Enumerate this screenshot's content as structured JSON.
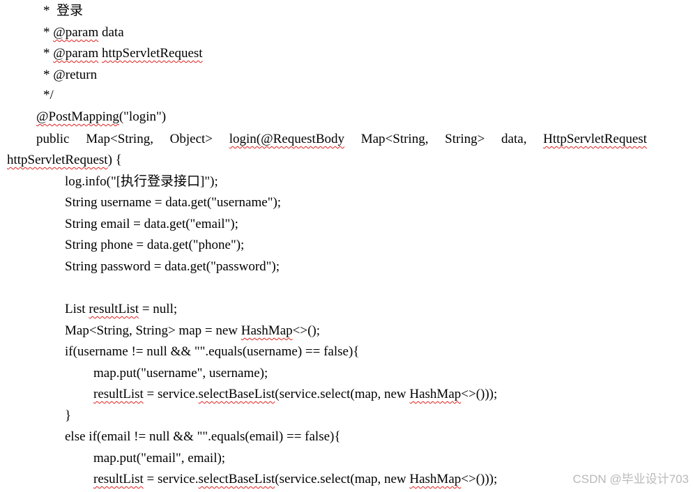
{
  "comment": {
    "l1_prefix": "*  ",
    "l1_text": "登录",
    "l2_prefix": "* ",
    "l2_tag": "@param",
    "l2_text": " data",
    "l3_prefix": "* ",
    "l3_tag": "@param",
    "l3_sep": " ",
    "l3_name": "httpServletRequest",
    "l4": "* @return",
    "l5": "*/"
  },
  "annotation": {
    "name": "@PostMapping",
    "arg": "(\"login\")"
  },
  "signature": {
    "tokens": [
      "public",
      "Map<String,",
      "Object>",
      "login(@RequestBody",
      "Map<String,",
      "String>",
      "data,",
      "HttpServletRequest"
    ],
    "squiggle_tokens": [
      3,
      7
    ],
    "line2_name": "httpServletRequest",
    "line2_rest": ") {"
  },
  "body": {
    "log": "log.info(\"[执行登录接口]\");",
    "username": "String username = data.get(\"username\");",
    "email": "String email = data.get(\"email\");",
    "phone": "String phone = data.get(\"phone\");",
    "password": "String password = data.get(\"password\");",
    "list_a": "List ",
    "list_b": "resultList",
    "list_c": " = null;",
    "map_a": "Map<String, String> map = new ",
    "map_b": "HashMap",
    "map_c": "<>();",
    "if1": "if(username != null && \"\".equals(username) == false){",
    "put_username": "map.put(\"username\", username);",
    "rl1_a": "resultList",
    "rl1_b": " = service.",
    "rl1_c": "selectBaseList",
    "rl1_d": "(service.select(map, new ",
    "rl1_e": "HashMap",
    "rl1_f": "<>()));",
    "close1": "}",
    "else_if": "else if(email != null && \"\".equals(email) == false){",
    "put_email": "map.put(\"email\", email);",
    "rl2_a": "resultList",
    "rl2_b": " = service.",
    "rl2_c": "selectBaseList",
    "rl2_d": "(service.select(map, new ",
    "rl2_e": "HashMap",
    "rl2_f": "<>()));"
  },
  "watermark": "CSDN @毕业设计703"
}
